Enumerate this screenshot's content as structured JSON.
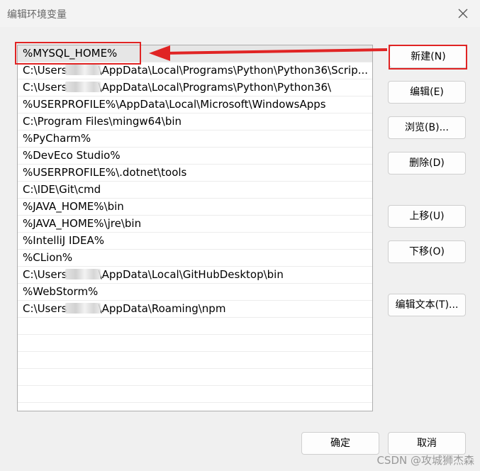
{
  "dialog": {
    "title": "编辑环境变量"
  },
  "path_list": {
    "items": [
      {
        "text": "%MYSQL_HOME%",
        "selected": true
      },
      {
        "pre": "C:\\Users",
        "redacted": true,
        "post": "\\AppData\\Local\\Programs\\Python\\Python36\\Scrip..."
      },
      {
        "pre": "C:\\Users",
        "redacted": true,
        "post": "\\AppData\\Local\\Programs\\Python\\Python36\\"
      },
      {
        "text": "%USERPROFILE%\\AppData\\Local\\Microsoft\\WindowsApps"
      },
      {
        "text": "C:\\Program Files\\mingw64\\bin"
      },
      {
        "text": "%PyCharm%"
      },
      {
        "text": "%DevEco Studio%"
      },
      {
        "text": "%USERPROFILE%\\.dotnet\\tools"
      },
      {
        "text": "C:\\IDE\\Git\\cmd"
      },
      {
        "text": "%JAVA_HOME%\\bin"
      },
      {
        "text": "%JAVA_HOME%\\jre\\bin"
      },
      {
        "text": "%IntelliJ IDEA%"
      },
      {
        "text": "%CLion%"
      },
      {
        "pre": "C:\\Users",
        "redacted": true,
        "post": "\\AppData\\Local\\GitHubDesktop\\bin"
      },
      {
        "text": "%WebStorm%"
      },
      {
        "pre": "C:\\Users",
        "redacted": true,
        "post": "\\AppData\\Roaming\\npm"
      }
    ],
    "empty_rows": 6
  },
  "buttons": {
    "new": "新建(N)",
    "edit": "编辑(E)",
    "browse": "浏览(B)...",
    "delete": "删除(D)",
    "move_up": "上移(U)",
    "move_down": "下移(O)",
    "edit_text": "编辑文本(T)...",
    "ok": "确定",
    "cancel": "取消"
  },
  "annotation": {
    "color": "#e02424"
  },
  "watermark": "CSDN @攻城狮杰森"
}
